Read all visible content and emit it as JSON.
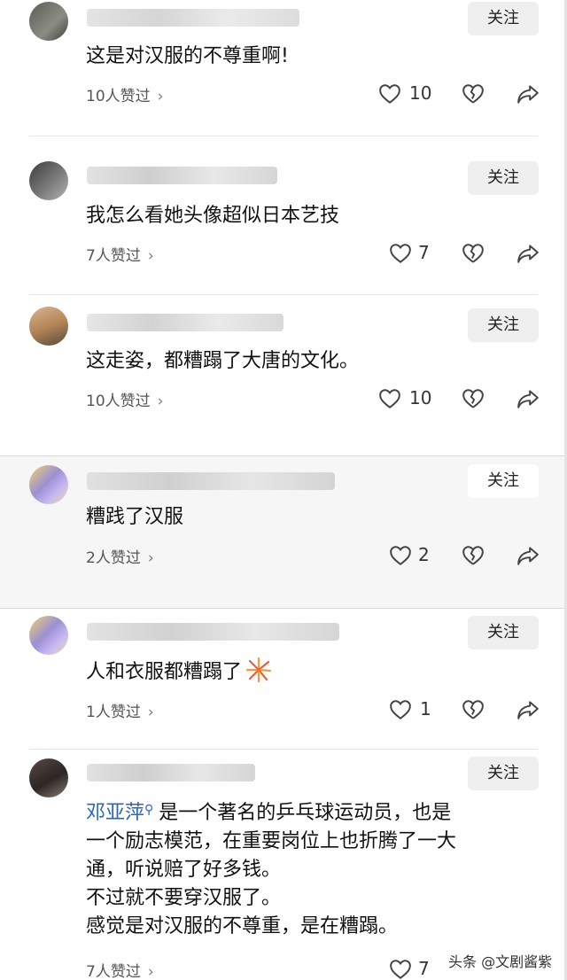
{
  "follow_label": "关注",
  "watermark": "头条 @文剧酱紫",
  "comments": [
    {
      "text": "这是对汉服的不尊重啊!",
      "likes_label": "10人赞过",
      "like_count": "10"
    },
    {
      "text": "我怎么看她头像超似日本艺技",
      "likes_label": "7人赞过",
      "like_count": "7"
    },
    {
      "text": "这走姿，都糟蹋了大唐的文化。",
      "likes_label": "10人赞过",
      "like_count": "10"
    },
    {
      "text": "糟践了汉服",
      "likes_label": "2人赞过",
      "like_count": "2"
    },
    {
      "text": "人和衣服都糟蹋了",
      "likes_label": "1人赞过",
      "like_count": "1"
    },
    {
      "mention": "邓亚萍",
      "text_after_mention": "是一个著名的乒乓球运动员，也是",
      "lines": [
        "一个励志模范，在重要岗位上也折腾了一大",
        "通，听说赔了好多钱。",
        "不过就不要穿汉服了。",
        "感觉是对汉服的不尊重，是在糟蹋。"
      ],
      "likes_label": "7人赞过",
      "like_count": "7"
    }
  ]
}
